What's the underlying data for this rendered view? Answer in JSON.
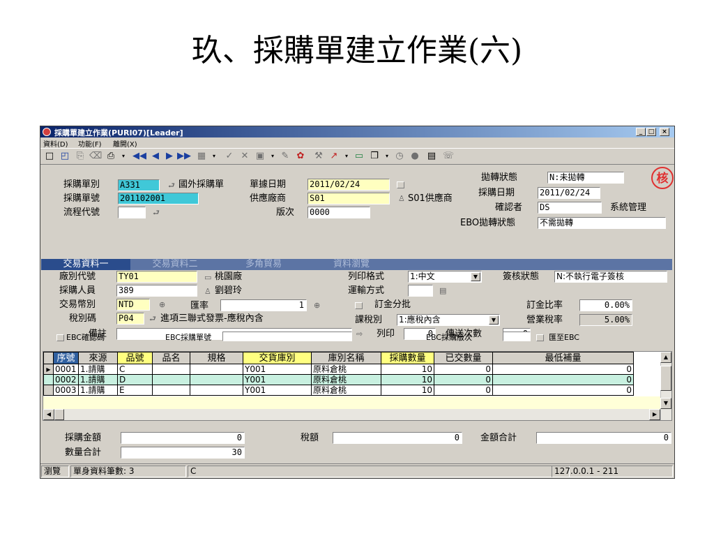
{
  "slide_title": "玖、採購單建立作業(六)",
  "window": {
    "title": "採購單建立作業(PURI07)[Leader]",
    "menu": [
      "資料(D)",
      "功能(F)",
      "離開(X)"
    ]
  },
  "header": {
    "order_type_label": "採購單別",
    "order_type_value": "A331",
    "order_type_name": "國外採購單",
    "doc_date_label": "單據日期",
    "doc_date_value": "2011/02/24",
    "order_no_label": "採購單號",
    "order_no_value": "201102001",
    "vendor_label": "供應廠商",
    "vendor_value": "S01",
    "vendor_name": "S01供應商",
    "flow_label": "流程代號",
    "version_label": "版次",
    "version_value": "0000",
    "transfer_status_label": "拋轉狀態",
    "transfer_status_value": "N:未拋轉",
    "purchase_date_label": "採購日期",
    "purchase_date_value": "2011/02/24",
    "confirmer_label": "確認者",
    "confirmer_value": "DS",
    "confirmer_name": "系統管理",
    "ebo_status_label": "EBO拋轉狀態",
    "ebo_status_value": "不需拋轉",
    "seal_text": "核"
  },
  "tabs": [
    "交易資料一",
    "交易資料二",
    "多角貿易",
    "資料瀏覽"
  ],
  "form": {
    "factory_label": "廠別代號",
    "factory_value": "TY01",
    "factory_name": "桃園廠",
    "buyer_label": "採購人員",
    "buyer_value": "389",
    "buyer_name": "劉碧玲",
    "currency_label": "交易幣別",
    "currency_value": "NTD",
    "rate_label": "匯率",
    "rate_value": "1",
    "tax_code_label": "稅別碼",
    "tax_code_value": "P04",
    "tax_code_name": "進項三聯式發票-應稅內含",
    "remark_label": "備註",
    "print_format_label": "列印格式",
    "print_format_value": "1:中文",
    "shipping_label": "運輸方式",
    "deposit_label": "訂金分批",
    "tax_type_label": "課稅別",
    "tax_type_value": "1:應稅內含",
    "print_label": "列印",
    "print_value": "0",
    "send_count_label": "傳送次數",
    "send_count_value": "0",
    "sign_status_label": "簽核狀態",
    "sign_status_value": "N:不執行電子簽核",
    "deposit_ratio_label": "訂金比率",
    "deposit_ratio_value": "0.00%",
    "business_tax_label": "營業稅率",
    "business_tax_value": "5.00%",
    "ebc_confirm_label": "EBC確認碼",
    "ebc_order_label": "EBC採購單號",
    "ebc_version_label": "EBC採購版次",
    "to_ebc_label": "匯至EBC"
  },
  "grid": {
    "columns": [
      "序號",
      "來源",
      "品號",
      "品名",
      "規格",
      "交貨庫別",
      "庫別名稱",
      "採購數量",
      "已交數量",
      "最低補量"
    ],
    "rows": [
      [
        "0001",
        "1.請購",
        "C",
        "",
        "",
        "Y001",
        "原料倉桃",
        "10",
        "0",
        "0"
      ],
      [
        "0002",
        "1.請購",
        "D",
        "",
        "",
        "Y001",
        "原料倉桃",
        "10",
        "0",
        "0"
      ],
      [
        "0003",
        "1.請購",
        "E",
        "",
        "",
        "Y001",
        "原料倉桃",
        "10",
        "0",
        "0"
      ]
    ]
  },
  "totals": {
    "amount_label": "採購金額",
    "amount_value": "0",
    "tax_label": "稅額",
    "tax_value": "0",
    "total_label": "金額合計",
    "total_value": "0",
    "qty_label": "數量合計",
    "qty_value": "30"
  },
  "status": {
    "mode": "瀏覽",
    "record_count": "單身資料筆數: 3",
    "current": "C",
    "server": "127.0.0.1 - 211"
  }
}
